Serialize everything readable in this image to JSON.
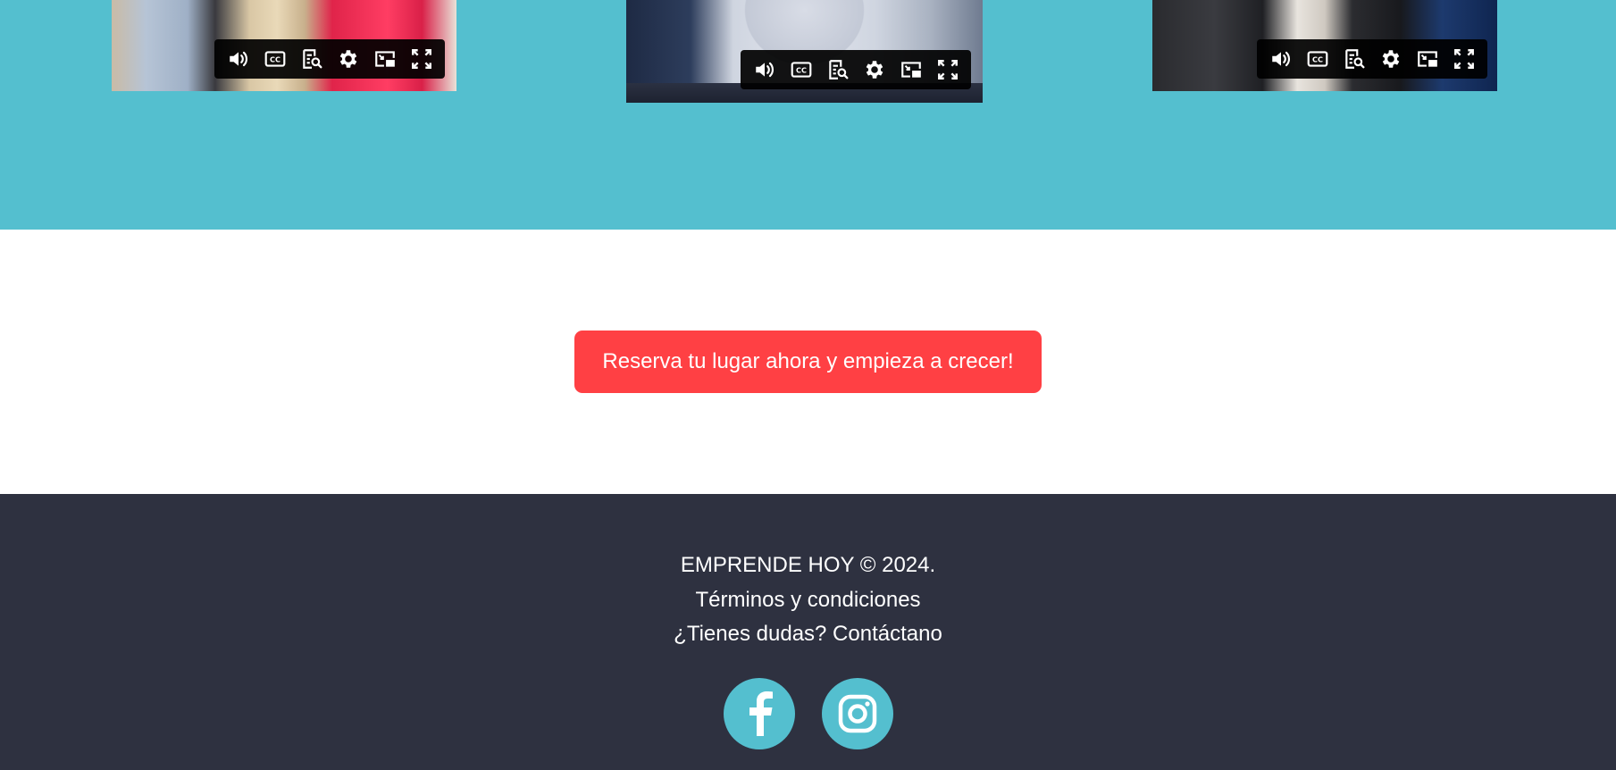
{
  "colors": {
    "teal_band": "#54bfcf",
    "cta_background": "#ff4044",
    "footer_background": "#2e3140",
    "social_circle": "#54bfcf",
    "text_light": "#ffffff"
  },
  "videos": [
    {
      "controls": [
        "volume-icon",
        "closed-captions-icon",
        "transcript-search-icon",
        "settings-gear-icon",
        "picture-in-picture-icon",
        "fullscreen-icon"
      ]
    },
    {
      "controls": [
        "volume-icon",
        "closed-captions-icon",
        "transcript-search-icon",
        "settings-gear-icon",
        "picture-in-picture-icon",
        "fullscreen-icon"
      ]
    },
    {
      "controls": [
        "volume-icon",
        "closed-captions-icon",
        "transcript-search-icon",
        "settings-gear-icon",
        "picture-in-picture-icon",
        "fullscreen-icon"
      ]
    }
  ],
  "cta": {
    "label": "Reserva tu lugar ahora y empieza a crecer!"
  },
  "footer": {
    "copyright": "EMPRENDE HOY © 2024.",
    "terms_link": "Términos y condiciones",
    "contact_link": "¿Tienes dudas? Contáctano"
  },
  "social": [
    {
      "icon": "facebook-icon"
    },
    {
      "icon": "instagram-icon"
    }
  ]
}
